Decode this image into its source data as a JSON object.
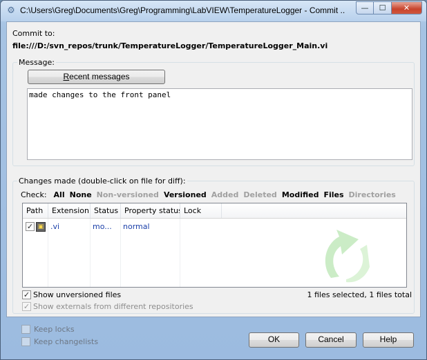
{
  "window": {
    "title": "C:\\Users\\Greg\\Documents\\Greg\\Programming\\LabVIEW\\TemperatureLogger - Commit ...",
    "minimize_glyph": "—",
    "maximize_glyph": "☐",
    "close_glyph": "✕"
  },
  "commit": {
    "label": "Commit to:",
    "url": "file:///D:/svn_repos/trunk/TemperatureLogger/TemperatureLogger_Main.vi"
  },
  "message": {
    "group_label": "Message:",
    "recent_button": "Recent messages",
    "recent_button_accel": "R",
    "text": "made changes to the front panel"
  },
  "changes": {
    "group_label": "Changes made (double-click on file for diff):",
    "check_label": "Check:",
    "filters": [
      {
        "label": "All",
        "enabled": true
      },
      {
        "label": "None",
        "enabled": true
      },
      {
        "label": "Non-versioned",
        "enabled": false
      },
      {
        "label": "Versioned",
        "enabled": true
      },
      {
        "label": "Added",
        "enabled": false
      },
      {
        "label": "Deleted",
        "enabled": false
      },
      {
        "label": "Modified",
        "enabled": true
      },
      {
        "label": "Files",
        "enabled": true
      },
      {
        "label": "Directories",
        "enabled": false
      }
    ],
    "columns": [
      "Path",
      "Extension",
      "Status",
      "Property status",
      "Lock"
    ],
    "rows": [
      {
        "checked": true,
        "extension": ".vi",
        "status": "mo...",
        "property_status": "normal",
        "lock": ""
      }
    ],
    "show_unversioned": {
      "label": "Show unversioned files",
      "checked": true
    },
    "show_externals": {
      "label": "Show externals from different repositories",
      "checked": true,
      "enabled": false
    },
    "summary": "1 files selected, 1 files total"
  },
  "footer": {
    "keep_locks": "Keep locks",
    "keep_changelists": "Keep changelists",
    "ok": "OK",
    "cancel": "Cancel",
    "help": "Help"
  },
  "colors": {
    "link_blue": "#1a3fa8",
    "disabled_gray": "#a0a0a0",
    "watermark_green": "#a8e0a0"
  }
}
